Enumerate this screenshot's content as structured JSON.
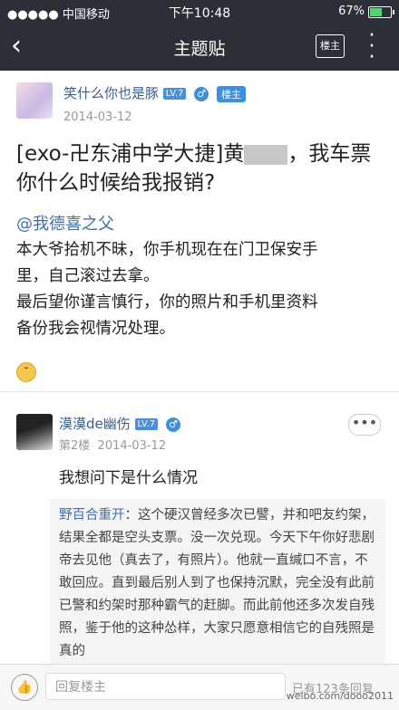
{
  "status_bar": {
    "carrier": "●●●●● 中国移动",
    "time": "下午10:48",
    "battery": "67%",
    "battery_level": 0.67
  },
  "nav": {
    "title": "主题贴",
    "back_icon": "chevron-left-icon",
    "op_only_label": "楼主",
    "more_icon": "vertical-dots-icon"
  },
  "post1": {
    "username": "笑什么你也是豚",
    "level": "LV.7",
    "gender": "♂",
    "op_badge": "楼主",
    "date": "2014-03-12",
    "title_before": "[exo-卍东浦中学大捷]黄",
    "title_after": "，我车票你什么时候给我报销?",
    "mention": "@我德喜之父",
    "body_lines": [
      "本大爷拾机不昧，你手机现在在门卫保安手",
      "里，自己滚过去拿。",
      "最后望你谨言慎行，你的照片和手机里资料",
      "备份我会视情况处理。"
    ],
    "emoji_icon": "face-emoji-icon"
  },
  "post2": {
    "username": "漠漠de幽伤",
    "level": "LV.7",
    "gender": "♂",
    "floor": "第2楼",
    "date": "2014-03-12",
    "more_label": "•••",
    "reply": "我想问下是什么情况",
    "quote_name": "野百合重开",
    "quote_text": "：这个硬汉曾经多次已譬，并和吧友约架，结果全都是空头支票。没一次兑现。今天下午你好悲剧帝去见他（真去了，有照片）。他就一直缄口不言，不敢回应。直到最后别人到了也保持沉默，完全没有此前已警和约架时那种霸气的赶脚。而此前他还多次发自残照，鉴于他的这种怂样，大家只愿意相信它的自残照是真的"
  },
  "footer": {
    "like_icon": "thumbs-up-icon",
    "reply_placeholder": "回复楼主",
    "reply_count": "已有123条回复",
    "watermark": "weibo.com/dooo2011"
  }
}
